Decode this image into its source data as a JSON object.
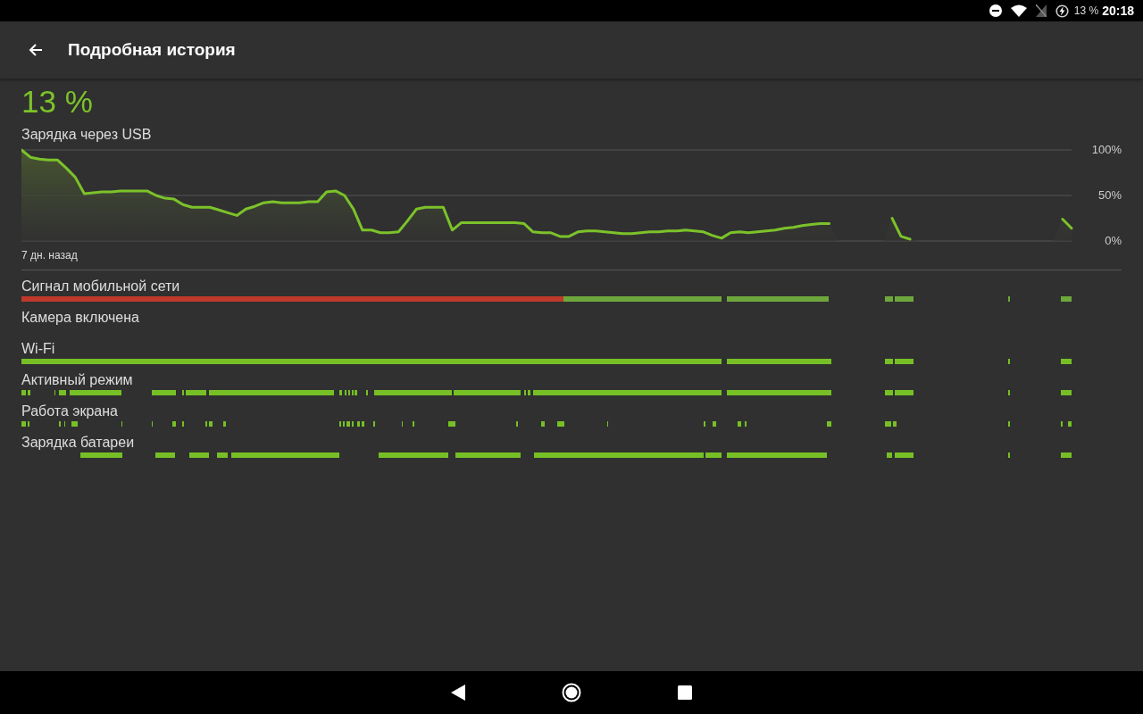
{
  "status_bar": {
    "battery": "13 %",
    "time": "20:18"
  },
  "app_bar": {
    "title": "Подробная история"
  },
  "battery": {
    "percent": "13 %",
    "status": "Зарядка через USB"
  },
  "chart": {
    "start_label": "7 дн. назад",
    "chart_data": {
      "type": "area",
      "ylim": [
        0,
        100
      ],
      "yticks": [
        {
          "value": 0,
          "label": "0%"
        },
        {
          "value": 50,
          "label": "50%"
        },
        {
          "value": 100,
          "label": "100%"
        }
      ],
      "categories": [
        null,
        null,
        null,
        null,
        null,
        null,
        null,
        null,
        null,
        null,
        null,
        null,
        null,
        null,
        null,
        null,
        null,
        null,
        null,
        null,
        null,
        null,
        null,
        null,
        null,
        null,
        null,
        null,
        null,
        null,
        null,
        null,
        null,
        null,
        null,
        null,
        null,
        null,
        null,
        null,
        null,
        null,
        null,
        null,
        null,
        null,
        null,
        null,
        null,
        null,
        null,
        null,
        null,
        null,
        null,
        null,
        null,
        null,
        null,
        null,
        null,
        null,
        null,
        null,
        null,
        null,
        null,
        null,
        null,
        null,
        null,
        null,
        null,
        null,
        null,
        null,
        null,
        null,
        null,
        null,
        null,
        null,
        null,
        null,
        null,
        null,
        null,
        null,
        null,
        null,
        null,
        null,
        null,
        null,
        null,
        null,
        null,
        null,
        null,
        null,
        null,
        null,
        null,
        null,
        null,
        null,
        null,
        null,
        null,
        null,
        null,
        null,
        null,
        null,
        null,
        null,
        null,
        null
      ],
      "series": [
        {
          "color": "#7cc22a",
          "values": [
            100,
            92,
            90,
            89,
            89,
            80,
            70,
            52,
            53,
            54,
            54,
            55,
            55,
            55,
            55,
            50,
            47,
            46,
            40,
            37,
            37,
            37,
            34,
            31,
            28,
            35,
            38,
            42,
            43,
            42,
            42,
            42,
            43,
            43,
            54,
            55,
            50,
            35,
            12,
            12,
            9,
            9,
            10,
            22,
            35,
            37,
            37,
            37,
            12,
            20,
            20,
            20,
            20,
            20,
            20,
            20,
            19,
            10,
            9,
            9,
            5,
            5,
            10,
            11,
            11,
            10,
            9,
            8,
            8,
            9,
            10,
            10,
            11,
            11,
            12,
            11,
            10,
            6,
            3,
            9,
            10,
            9,
            10,
            11,
            12,
            14,
            15,
            17,
            18,
            19,
            19,
            null,
            null,
            null,
            null,
            null,
            null,
            25,
            5,
            2,
            null,
            null,
            null,
            null,
            null,
            null,
            null,
            null,
            null,
            null,
            null,
            null,
            null,
            null,
            null,
            null,
            24,
            14
          ]
        }
      ]
    }
  },
  "timelines": [
    {
      "label": "Сигнал мобильной сети"
    },
    {
      "label": "Камера включена"
    },
    {
      "label": "Wi-Fi"
    },
    {
      "label": "Активный режим"
    },
    {
      "label": "Работа экрана"
    },
    {
      "label": "Зарядка батареи"
    }
  ]
}
